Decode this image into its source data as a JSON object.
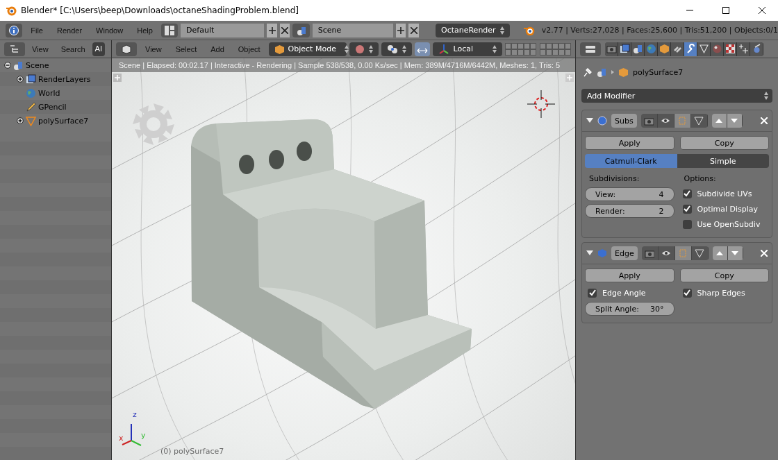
{
  "window": {
    "title": "Blender* [C:\\Users\\beep\\Downloads\\octaneShadingProblem.blend]"
  },
  "top_bar": {
    "menus": [
      "File",
      "Render",
      "Window",
      "Help"
    ],
    "layout": "Default",
    "scene": "Scene",
    "engine": "OctaneRender",
    "stats": "v2.77 | Verts:27,028 | Faces:25,600 | Tris:51,200 | Objects:0/1"
  },
  "outliner": {
    "menus": [
      "View",
      "Search"
    ],
    "display_mode": "Al",
    "tree": [
      {
        "label": "Scene",
        "kind": "scene",
        "expanded": true,
        "children": [
          {
            "label": "RenderLayers",
            "kind": "renderlayers",
            "expanded": false
          },
          {
            "label": "World",
            "kind": "world"
          },
          {
            "label": "GPencil",
            "kind": "gpencil"
          },
          {
            "label": "polySurface7",
            "kind": "mesh",
            "expanded": false
          }
        ]
      }
    ]
  },
  "viewport": {
    "menus": [
      "View",
      "Select",
      "Add",
      "Object"
    ],
    "mode": "Object Mode",
    "orientation": "Local",
    "info": "Scene | Elapsed: 00:02.17 | Interactive - Rendering | Sample 538/538, 0.00 Ks/sec | Mem: 389M/4716M/6442M, Meshes: 1, Tris: 5",
    "axes": [
      "x",
      "y",
      "z"
    ],
    "object_label": "(0) polySurface7"
  },
  "properties": {
    "tabs": [
      {
        "kind": "render",
        "selected": false
      },
      {
        "kind": "renderlayers",
        "selected": false
      },
      {
        "kind": "scene",
        "selected": false
      },
      {
        "kind": "world",
        "selected": false
      },
      {
        "kind": "object",
        "selected": false
      },
      {
        "kind": "constraints",
        "selected": false
      },
      {
        "kind": "modifiers",
        "selected": true
      },
      {
        "kind": "data",
        "selected": false
      },
      {
        "kind": "material",
        "selected": false
      },
      {
        "kind": "texture",
        "selected": false
      },
      {
        "kind": "particles",
        "selected": false
      },
      {
        "kind": "physics",
        "selected": false
      }
    ],
    "object": "polySurface7",
    "add_modifier": "Add Modifier",
    "modifiers": [
      {
        "kind": "subsurf",
        "name": "Subs",
        "buttons": [
          "Apply",
          "Copy"
        ],
        "algorithms": [
          {
            "label": "Catmull-Clark",
            "selected": true
          },
          {
            "label": "Simple",
            "selected": false
          }
        ],
        "subdivisions_label": "Subdivisions:",
        "fields": [
          {
            "label": "View:",
            "value": "4"
          },
          {
            "label": "Render:",
            "value": "2"
          }
        ],
        "options_label": "Options:",
        "options": [
          {
            "label": "Subdivide UVs",
            "checked": true
          },
          {
            "label": "Optimal Display",
            "checked": true
          },
          {
            "label": "Use OpenSubdiv",
            "checked": false
          }
        ]
      },
      {
        "kind": "edgesplit",
        "name": "Edge",
        "buttons": [
          "Apply",
          "Copy"
        ],
        "options": [
          {
            "label": "Edge Angle",
            "checked": true
          },
          {
            "label": "Sharp Edges",
            "checked": true
          }
        ],
        "fields": [
          {
            "label": "Split Angle:",
            "value": "30°"
          }
        ]
      }
    ]
  }
}
